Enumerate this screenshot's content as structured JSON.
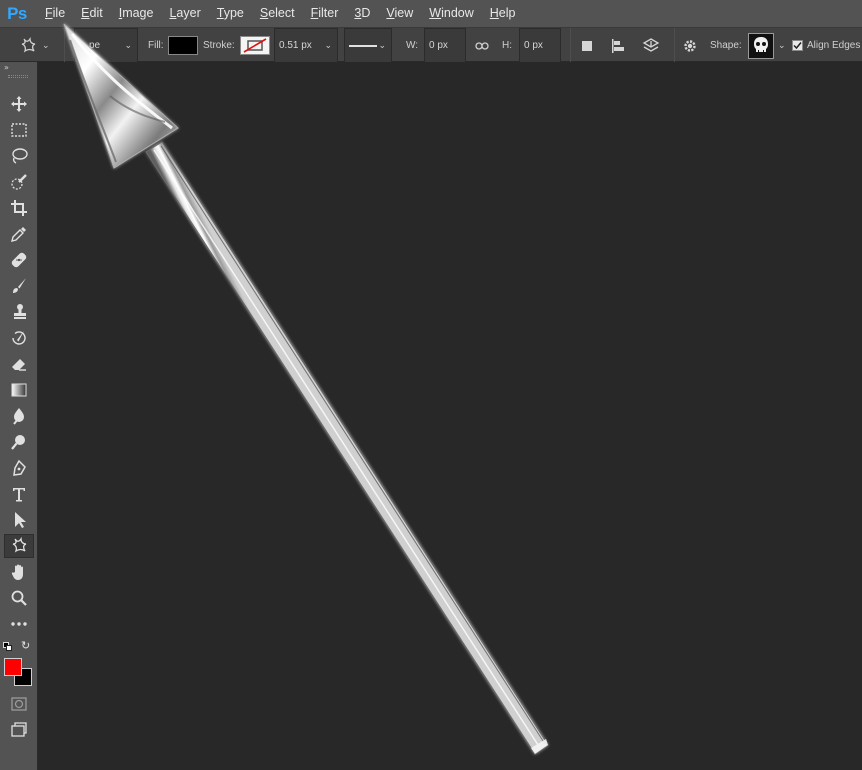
{
  "app": {
    "logo": "Ps",
    "menu": [
      {
        "label": "File",
        "underline": "F",
        "rest": "ile"
      },
      {
        "label": "Edit",
        "underline": "E",
        "rest": "dit"
      },
      {
        "label": "Image",
        "underline": "I",
        "rest": "mage"
      },
      {
        "label": "Layer",
        "underline": "L",
        "rest": "ayer"
      },
      {
        "label": "Type",
        "underline": "T",
        "rest": "ype"
      },
      {
        "label": "Select",
        "underline": "S",
        "rest": "elect"
      },
      {
        "label": "Filter",
        "underline": "F",
        "rest": "ilter"
      },
      {
        "label": "3D",
        "underline": "3",
        "rest": "D"
      },
      {
        "label": "View",
        "underline": "V",
        "rest": "iew"
      },
      {
        "label": "Window",
        "underline": "W",
        "rest": "indow"
      },
      {
        "label": "Help",
        "underline": "H",
        "rest": "elp"
      }
    ]
  },
  "options": {
    "mode_value": "pe",
    "fill_label": "Fill:",
    "fill_color": "#000000",
    "stroke_label": "Stroke:",
    "stroke_width": "0.51 px",
    "w_label": "W:",
    "w_value": "0 px",
    "h_label": "H:",
    "h_value": "0 px",
    "shape_label": "Shape:",
    "align_edges_label": "Align Edges",
    "align_edges_checked": true
  },
  "colors": {
    "foreground": "#ff0000",
    "background": "#000000",
    "accent": "#31a8ff"
  },
  "tools": [
    "move-icon",
    "marquee-icon",
    "lasso-icon",
    "quick-select-icon",
    "crop-icon",
    "eyedropper-icon",
    "healing-icon",
    "brush-icon",
    "clone-stamp-icon",
    "history-brush-icon",
    "eraser-icon",
    "gradient-icon",
    "blur-icon",
    "dodge-icon",
    "pen-icon",
    "type-icon",
    "path-select-icon",
    "custom-shape-icon",
    "hand-icon",
    "zoom-icon",
    "more-icon"
  ],
  "active_tool": "custom-shape-icon"
}
